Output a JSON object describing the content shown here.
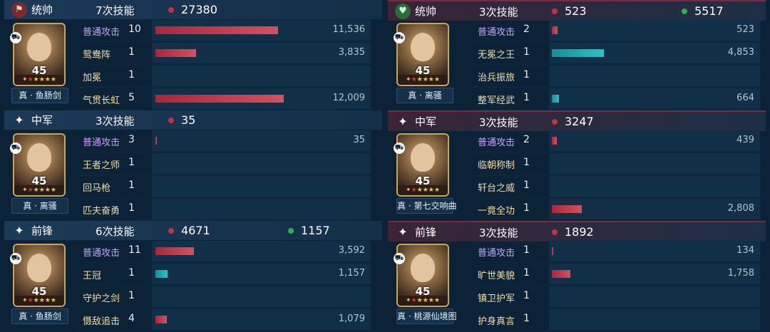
{
  "left": [
    {
      "role": "统帅",
      "role_icon": "banner-icon",
      "casts": "7次技能",
      "damage": "27380",
      "heal": "",
      "hero_name": "真 · 鱼肠剑",
      "level": "45",
      "skills": [
        {
          "name": "普通攻击",
          "count": "10",
          "value": "11,536",
          "fill": 0.957,
          "color": "red",
          "basic": true
        },
        {
          "name": "鸳鸯阵",
          "count": "1",
          "value": "3,835",
          "fill": 0.318,
          "color": "red"
        },
        {
          "name": "加冕",
          "count": "1",
          "value": "",
          "fill": 0,
          "color": "red"
        },
        {
          "name": "气贯长虹",
          "count": "5",
          "value": "12,009",
          "fill": 1.0,
          "color": "red"
        }
      ]
    },
    {
      "role": "中军",
      "role_icon": "sparkle-icon",
      "casts": "3次技能",
      "damage": "35",
      "heal": "",
      "hero_name": "真 · 离骚",
      "level": "45",
      "skills": [
        {
          "name": "普通攻击",
          "count": "3",
          "value": "35",
          "fill": 0.005,
          "color": "red",
          "basic": true
        },
        {
          "name": "王者之师",
          "count": "1",
          "value": "",
          "fill": 0,
          "color": "red"
        },
        {
          "name": "回马枪",
          "count": "1",
          "value": "",
          "fill": 0,
          "color": "red"
        },
        {
          "name": "匹夫奋勇",
          "count": "1",
          "value": "",
          "fill": 0,
          "color": "red"
        }
      ]
    },
    {
      "role": "前锋",
      "role_icon": "sparkle-icon",
      "casts": "6次技能",
      "damage": "4671",
      "heal": "1157",
      "hero_name": "真 · 鱼肠剑",
      "level": "45",
      "skills": [
        {
          "name": "普通攻击",
          "count": "11",
          "value": "3,592",
          "fill": 0.298,
          "color": "red",
          "basic": true
        },
        {
          "name": "王冠",
          "count": "1",
          "value": "1,157",
          "fill": 0.096,
          "color": "teal"
        },
        {
          "name": "守护之剑",
          "count": "1",
          "value": "",
          "fill": 0,
          "color": "red"
        },
        {
          "name": "慑敌追击",
          "count": "4",
          "value": "1,079",
          "fill": 0.09,
          "color": "red"
        }
      ]
    }
  ],
  "right": [
    {
      "role": "统帅",
      "role_icon": "banner-icon",
      "casts": "3次技能",
      "damage": "523",
      "heal": "5517",
      "hero_name": "真 · 离骚",
      "level": "45",
      "skills": [
        {
          "name": "普通攻击",
          "count": "2",
          "value": "523",
          "fill": 0.043,
          "color": "red",
          "basic": true
        },
        {
          "name": "无冕之王",
          "count": "1",
          "value": "4,853",
          "fill": 0.404,
          "color": "teal"
        },
        {
          "name": "治兵振旅",
          "count": "1",
          "value": "",
          "fill": 0,
          "color": "red"
        },
        {
          "name": "整军经武",
          "count": "1",
          "value": "664",
          "fill": 0.055,
          "color": "teal"
        }
      ]
    },
    {
      "role": "中军",
      "role_icon": "sparkle-icon",
      "casts": "3次技能",
      "damage": "3247",
      "heal": "",
      "hero_name": "真 · 第七交响曲",
      "level": "45",
      "skills": [
        {
          "name": "普通攻击",
          "count": "2",
          "value": "439",
          "fill": 0.037,
          "color": "red",
          "basic": true
        },
        {
          "name": "临朝称制",
          "count": "1",
          "value": "",
          "fill": 0,
          "color": "red"
        },
        {
          "name": "轩台之威",
          "count": "1",
          "value": "",
          "fill": 0,
          "color": "red"
        },
        {
          "name": "一竟全功",
          "count": "1",
          "value": "2,808",
          "fill": 0.234,
          "color": "red"
        }
      ]
    },
    {
      "role": "前锋",
      "role_icon": "sparkle-icon",
      "casts": "3次技能",
      "damage": "1892",
      "heal": "",
      "hero_name": "真 · 桃源仙境图",
      "level": "45",
      "skills": [
        {
          "name": "普通攻击",
          "count": "1",
          "value": "134",
          "fill": 0.011,
          "color": "red",
          "basic": true
        },
        {
          "name": "旷世美貌",
          "count": "1",
          "value": "1,758",
          "fill": 0.146,
          "color": "red"
        },
        {
          "name": "镇卫护军",
          "count": "1",
          "value": "",
          "fill": 0,
          "color": "red"
        },
        {
          "name": "护身真言",
          "count": "1",
          "value": "",
          "fill": 0,
          "color": "red"
        }
      ]
    }
  ]
}
